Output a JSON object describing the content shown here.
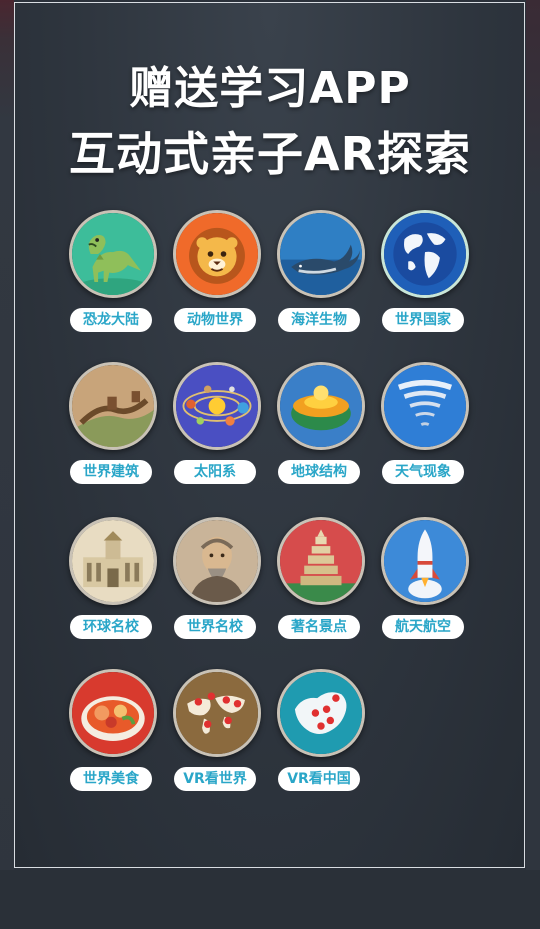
{
  "title_line1": "赠送学习APP",
  "title_line2": "互动式亲子AR探索",
  "items": [
    {
      "label": "恐龙大陆",
      "icon": "dinosaur-icon",
      "bg": "#3dbd9a"
    },
    {
      "label": "动物世界",
      "icon": "lion-icon",
      "bg": "#f06a2a"
    },
    {
      "label": "海洋生物",
      "icon": "whale-icon",
      "bg": "#2f7fc4"
    },
    {
      "label": "世界国家",
      "icon": "globe-icon",
      "bg": "#1f5fb8"
    },
    {
      "label": "世界建筑",
      "icon": "great-wall-icon",
      "bg": "#c8a47a"
    },
    {
      "label": "太阳系",
      "icon": "solar-system-icon",
      "bg": "#4a4fc2"
    },
    {
      "label": "地球结构",
      "icon": "earth-layers-icon",
      "bg": "#3a7fc8"
    },
    {
      "label": "天气现象",
      "icon": "tornado-icon",
      "bg": "#2f7ed6"
    },
    {
      "label": "环球名校",
      "icon": "university-building-icon",
      "bg": "#e8dcc2"
    },
    {
      "label": "世界名校",
      "icon": "scholar-portrait-icon",
      "bg": "#c9b499"
    },
    {
      "label": "著名景点",
      "icon": "pagoda-icon",
      "bg": "#d64c4c"
    },
    {
      "label": "航天航空",
      "icon": "rocket-icon",
      "bg": "#3d8ad8"
    },
    {
      "label": "世界美食",
      "icon": "food-plate-icon",
      "bg": "#d83a2e"
    },
    {
      "label": "VR看世界",
      "icon": "world-map-pins-icon",
      "bg": "#8b6a3e"
    },
    {
      "label": "VR看中国",
      "icon": "china-map-pins-icon",
      "bg": "#1f9bb0"
    }
  ],
  "colors": {
    "label_text": "#2aa6c8",
    "panel_border": "#d9dde2",
    "background": "#2b313a"
  }
}
